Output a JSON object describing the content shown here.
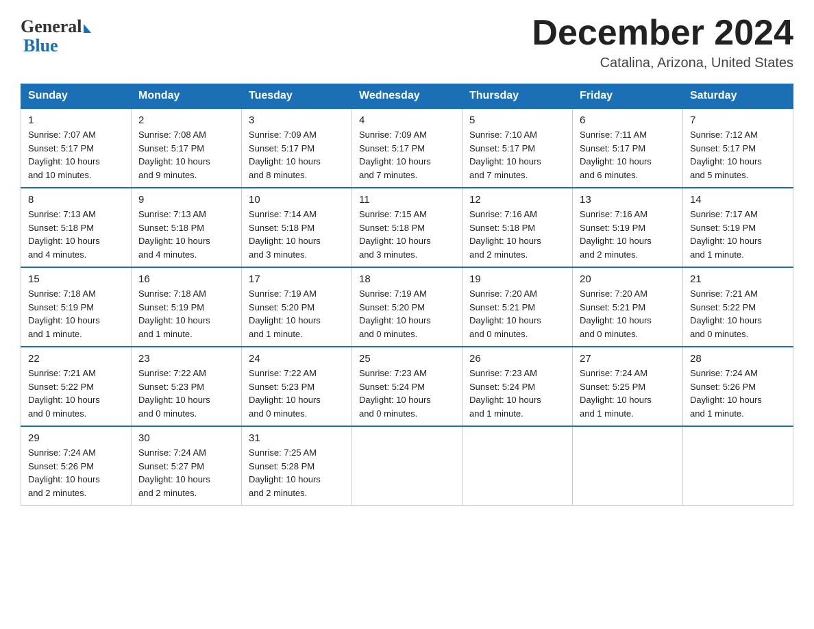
{
  "header": {
    "main_title": "December 2024",
    "subtitle": "Catalina, Arizona, United States",
    "logo_line1": "General",
    "logo_line2": "Blue"
  },
  "days_of_week": [
    "Sunday",
    "Monday",
    "Tuesday",
    "Wednesday",
    "Thursday",
    "Friday",
    "Saturday"
  ],
  "weeks": [
    [
      {
        "day": "1",
        "sunrise": "7:07 AM",
        "sunset": "5:17 PM",
        "daylight": "10 hours and 10 minutes."
      },
      {
        "day": "2",
        "sunrise": "7:08 AM",
        "sunset": "5:17 PM",
        "daylight": "10 hours and 9 minutes."
      },
      {
        "day": "3",
        "sunrise": "7:09 AM",
        "sunset": "5:17 PM",
        "daylight": "10 hours and 8 minutes."
      },
      {
        "day": "4",
        "sunrise": "7:09 AM",
        "sunset": "5:17 PM",
        "daylight": "10 hours and 7 minutes."
      },
      {
        "day": "5",
        "sunrise": "7:10 AM",
        "sunset": "5:17 PM",
        "daylight": "10 hours and 7 minutes."
      },
      {
        "day": "6",
        "sunrise": "7:11 AM",
        "sunset": "5:17 PM",
        "daylight": "10 hours and 6 minutes."
      },
      {
        "day": "7",
        "sunrise": "7:12 AM",
        "sunset": "5:17 PM",
        "daylight": "10 hours and 5 minutes."
      }
    ],
    [
      {
        "day": "8",
        "sunrise": "7:13 AM",
        "sunset": "5:18 PM",
        "daylight": "10 hours and 4 minutes."
      },
      {
        "day": "9",
        "sunrise": "7:13 AM",
        "sunset": "5:18 PM",
        "daylight": "10 hours and 4 minutes."
      },
      {
        "day": "10",
        "sunrise": "7:14 AM",
        "sunset": "5:18 PM",
        "daylight": "10 hours and 3 minutes."
      },
      {
        "day": "11",
        "sunrise": "7:15 AM",
        "sunset": "5:18 PM",
        "daylight": "10 hours and 3 minutes."
      },
      {
        "day": "12",
        "sunrise": "7:16 AM",
        "sunset": "5:18 PM",
        "daylight": "10 hours and 2 minutes."
      },
      {
        "day": "13",
        "sunrise": "7:16 AM",
        "sunset": "5:19 PM",
        "daylight": "10 hours and 2 minutes."
      },
      {
        "day": "14",
        "sunrise": "7:17 AM",
        "sunset": "5:19 PM",
        "daylight": "10 hours and 1 minute."
      }
    ],
    [
      {
        "day": "15",
        "sunrise": "7:18 AM",
        "sunset": "5:19 PM",
        "daylight": "10 hours and 1 minute."
      },
      {
        "day": "16",
        "sunrise": "7:18 AM",
        "sunset": "5:19 PM",
        "daylight": "10 hours and 1 minute."
      },
      {
        "day": "17",
        "sunrise": "7:19 AM",
        "sunset": "5:20 PM",
        "daylight": "10 hours and 1 minute."
      },
      {
        "day": "18",
        "sunrise": "7:19 AM",
        "sunset": "5:20 PM",
        "daylight": "10 hours and 0 minutes."
      },
      {
        "day": "19",
        "sunrise": "7:20 AM",
        "sunset": "5:21 PM",
        "daylight": "10 hours and 0 minutes."
      },
      {
        "day": "20",
        "sunrise": "7:20 AM",
        "sunset": "5:21 PM",
        "daylight": "10 hours and 0 minutes."
      },
      {
        "day": "21",
        "sunrise": "7:21 AM",
        "sunset": "5:22 PM",
        "daylight": "10 hours and 0 minutes."
      }
    ],
    [
      {
        "day": "22",
        "sunrise": "7:21 AM",
        "sunset": "5:22 PM",
        "daylight": "10 hours and 0 minutes."
      },
      {
        "day": "23",
        "sunrise": "7:22 AM",
        "sunset": "5:23 PM",
        "daylight": "10 hours and 0 minutes."
      },
      {
        "day": "24",
        "sunrise": "7:22 AM",
        "sunset": "5:23 PM",
        "daylight": "10 hours and 0 minutes."
      },
      {
        "day": "25",
        "sunrise": "7:23 AM",
        "sunset": "5:24 PM",
        "daylight": "10 hours and 0 minutes."
      },
      {
        "day": "26",
        "sunrise": "7:23 AM",
        "sunset": "5:24 PM",
        "daylight": "10 hours and 1 minute."
      },
      {
        "day": "27",
        "sunrise": "7:24 AM",
        "sunset": "5:25 PM",
        "daylight": "10 hours and 1 minute."
      },
      {
        "day": "28",
        "sunrise": "7:24 AM",
        "sunset": "5:26 PM",
        "daylight": "10 hours and 1 minute."
      }
    ],
    [
      {
        "day": "29",
        "sunrise": "7:24 AM",
        "sunset": "5:26 PM",
        "daylight": "10 hours and 2 minutes."
      },
      {
        "day": "30",
        "sunrise": "7:24 AM",
        "sunset": "5:27 PM",
        "daylight": "10 hours and 2 minutes."
      },
      {
        "day": "31",
        "sunrise": "7:25 AM",
        "sunset": "5:28 PM",
        "daylight": "10 hours and 2 minutes."
      },
      null,
      null,
      null,
      null
    ]
  ],
  "labels": {
    "sunrise": "Sunrise:",
    "sunset": "Sunset:",
    "daylight": "Daylight:"
  }
}
